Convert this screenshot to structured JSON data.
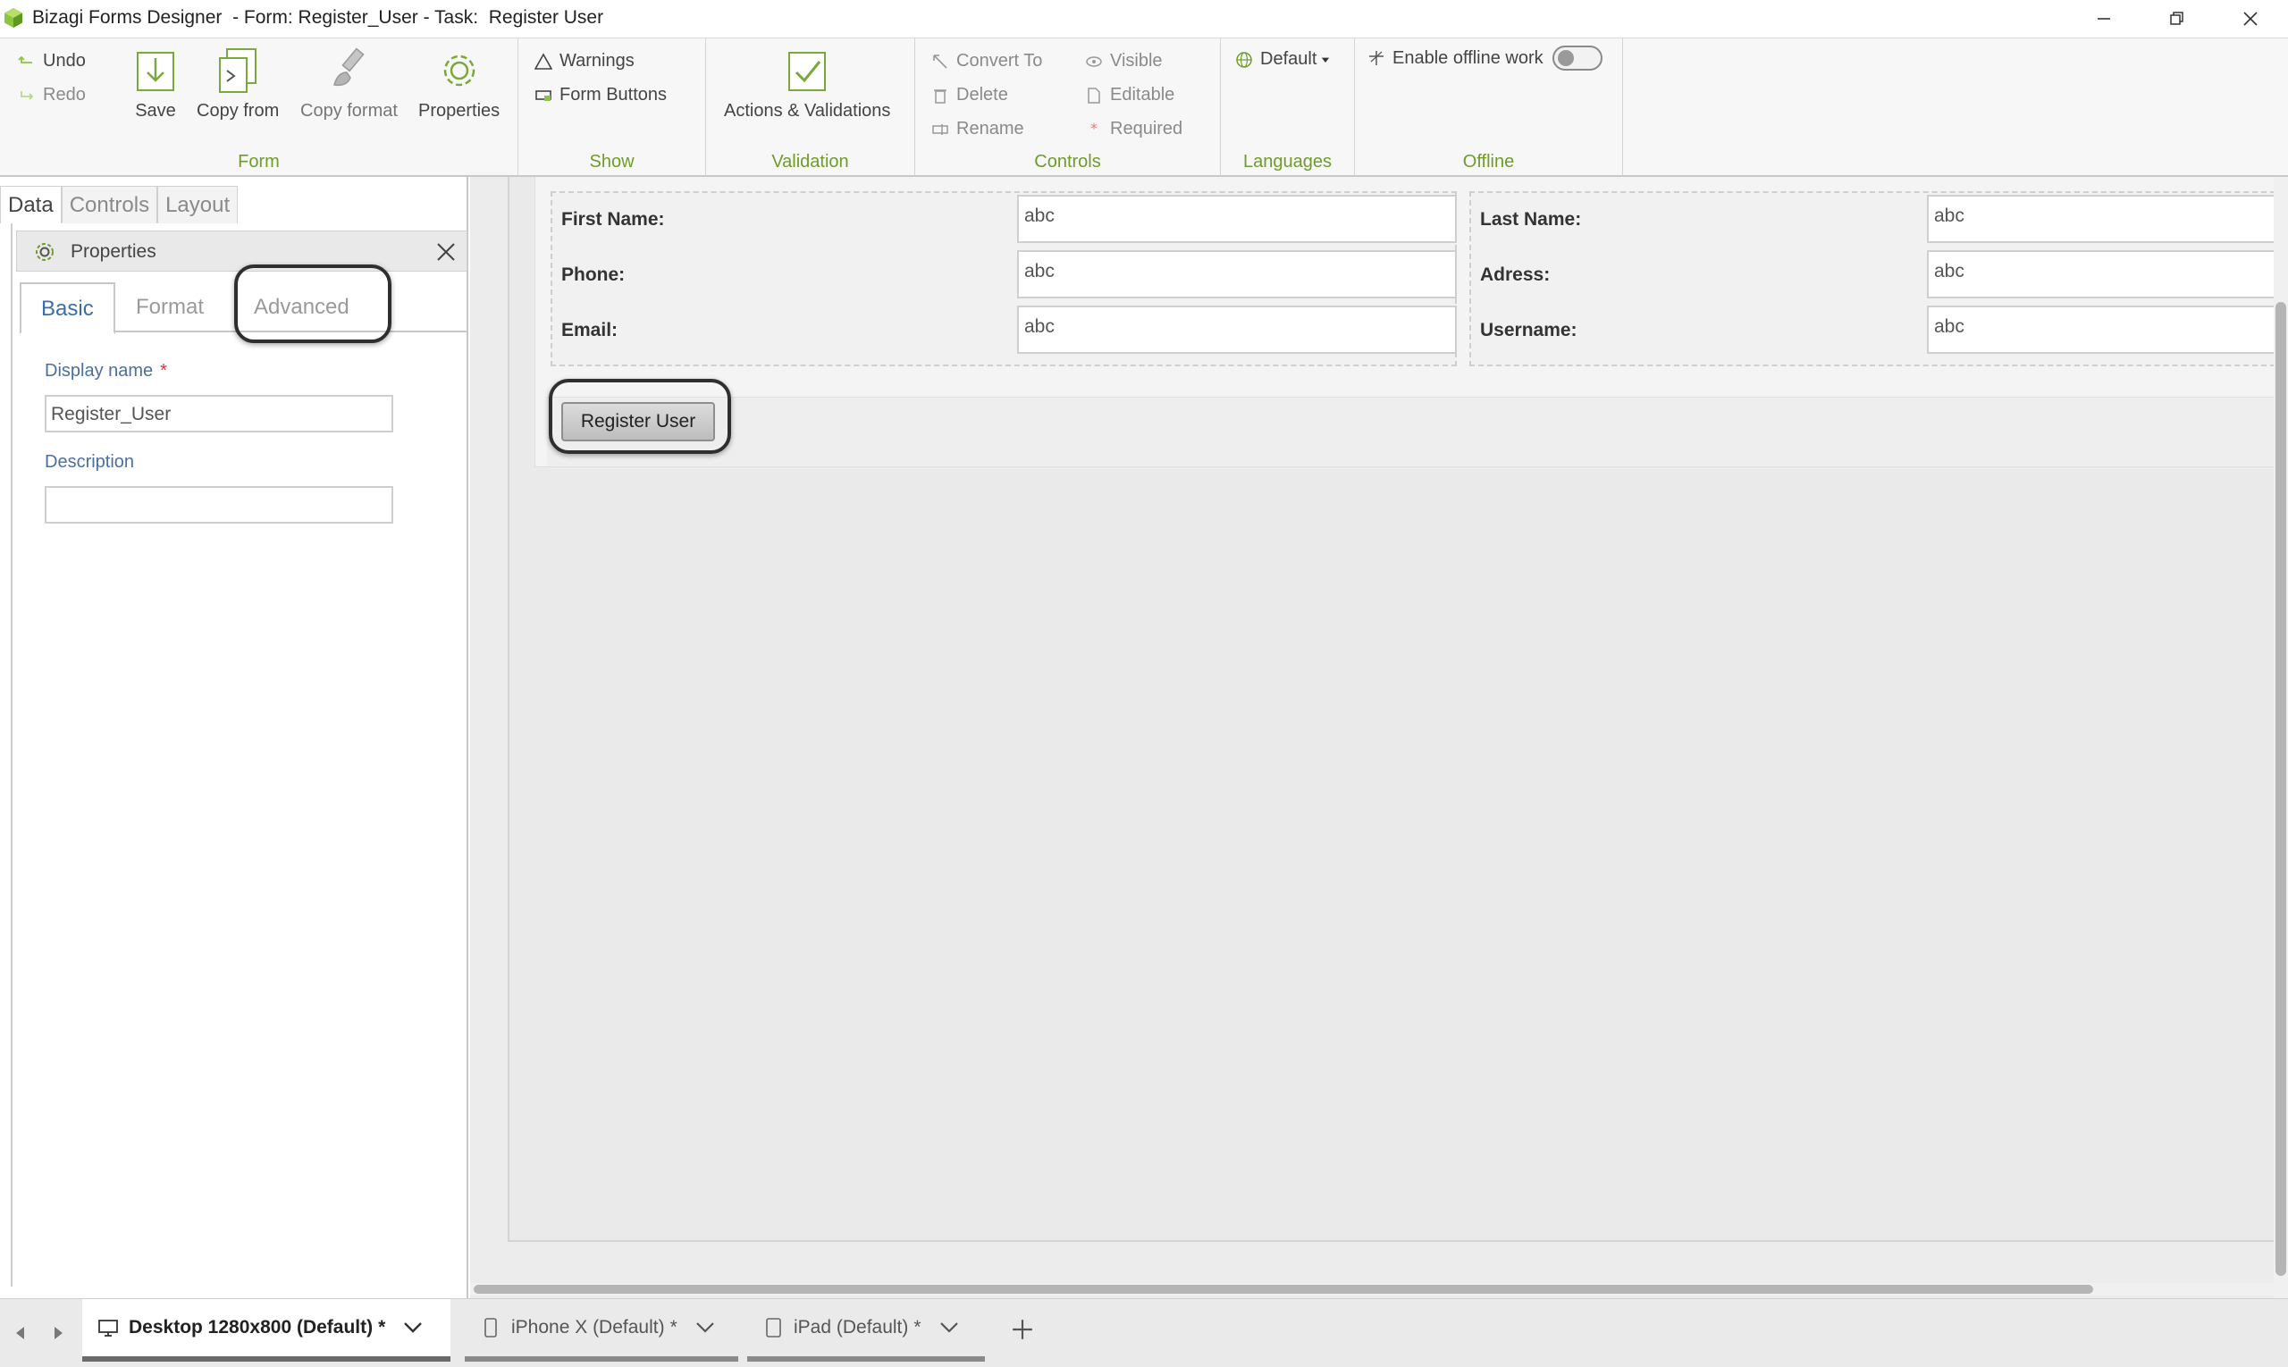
{
  "window": {
    "title": "Bizagi Forms Designer  - Form: Register_User - Task:  Register User"
  },
  "ribbon": {
    "form_group": {
      "label": "Form",
      "undo": "Undo",
      "redo": "Redo",
      "save": "Save",
      "copy_from": "Copy from",
      "copy_format": "Copy format",
      "properties": "Properties"
    },
    "show_group": {
      "label": "Show",
      "warnings": "Warnings",
      "form_buttons": "Form Buttons"
    },
    "validation_group": {
      "label": "Validation",
      "actions_validations": "Actions & Validations"
    },
    "controls_group": {
      "label": "Controls",
      "convert_to": "Convert To",
      "delete": "Delete",
      "rename": "Rename",
      "visible": "Visible",
      "editable": "Editable",
      "required": "Required"
    },
    "languages_group": {
      "label": "Languages",
      "default": "Default"
    },
    "offline_group": {
      "label": "Offline",
      "enable_offline": "Enable offline work"
    }
  },
  "left_panel": {
    "tabs": [
      "Data",
      "Controls",
      "Layout"
    ],
    "properties_title": "Properties",
    "prop_tabs": [
      "Basic",
      "Format",
      "Advanced"
    ],
    "display_name_label": "Display name",
    "required_mark": "*",
    "display_name_value": "Register_User",
    "description_label": "Description",
    "description_value": ""
  },
  "form": {
    "left_fields": [
      {
        "label": "First Name:",
        "value": "abc"
      },
      {
        "label": "Phone:",
        "value": "abc"
      },
      {
        "label": "Email:",
        "value": "abc"
      }
    ],
    "right_fields": [
      {
        "label": "Last Name:",
        "value": "abc"
      },
      {
        "label": "Adress:",
        "value": "abc"
      },
      {
        "label": "Username:",
        "value": "abc"
      }
    ],
    "button_label": "Register User"
  },
  "bottom_tabs": [
    {
      "label": "Desktop 1280x800 (Default)",
      "modified": "*"
    },
    {
      "label": "iPhone X (Default)",
      "modified": "*"
    },
    {
      "label": "iPad (Default)",
      "modified": "*"
    }
  ],
  "colors": {
    "accent_green": "#6f9c2b",
    "link_blue": "#4b6f9e",
    "required_red": "#e0322d"
  }
}
